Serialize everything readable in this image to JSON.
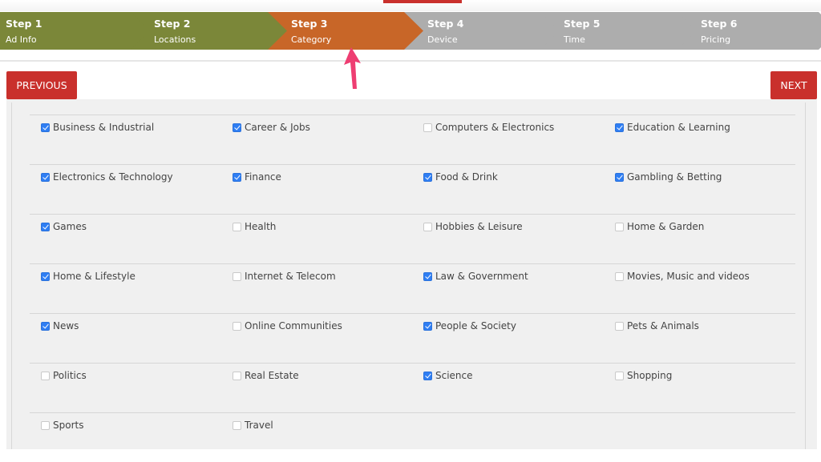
{
  "wizard": {
    "steps": [
      {
        "title": "Step 1",
        "subtitle": "Ad Info",
        "state": "done"
      },
      {
        "title": "Step 2",
        "subtitle": "Locations",
        "state": "done"
      },
      {
        "title": "Step 3",
        "subtitle": "Category",
        "state": "active"
      },
      {
        "title": "Step 4",
        "subtitle": "Device",
        "state": "todo"
      },
      {
        "title": "Step 5",
        "subtitle": "Time",
        "state": "todo"
      },
      {
        "title": "Step 6",
        "subtitle": "Pricing",
        "state": "todo"
      }
    ],
    "colors": {
      "done": "#7b8739",
      "active": "#c86628",
      "todo": "#adadad"
    }
  },
  "nav": {
    "previous_label": "PREVIOUS",
    "next_label": "NEXT",
    "button_color": "#c9302c"
  },
  "annotation": {
    "icon": "arrow-pointer-icon",
    "color": "#ee3e72",
    "points_to": "Step 3"
  },
  "categories": [
    [
      {
        "label": "Business & Industrial",
        "checked": true
      },
      {
        "label": "Career & Jobs",
        "checked": true
      },
      {
        "label": "Computers & Electronics",
        "checked": false
      },
      {
        "label": "Education & Learning",
        "checked": true
      }
    ],
    [
      {
        "label": "Electronics & Technology",
        "checked": true
      },
      {
        "label": "Finance",
        "checked": true
      },
      {
        "label": "Food & Drink",
        "checked": true
      },
      {
        "label": "Gambling & Betting",
        "checked": true
      }
    ],
    [
      {
        "label": "Games",
        "checked": true
      },
      {
        "label": "Health",
        "checked": false
      },
      {
        "label": "Hobbies & Leisure",
        "checked": false
      },
      {
        "label": "Home & Garden",
        "checked": false
      }
    ],
    [
      {
        "label": "Home & Lifestyle",
        "checked": true
      },
      {
        "label": "Internet & Telecom",
        "checked": false
      },
      {
        "label": "Law & Government",
        "checked": true
      },
      {
        "label": "Movies, Music and videos",
        "checked": false
      }
    ],
    [
      {
        "label": "News",
        "checked": true
      },
      {
        "label": "Online Communities",
        "checked": false
      },
      {
        "label": "People & Society",
        "checked": true
      },
      {
        "label": "Pets & Animals",
        "checked": false
      }
    ],
    [
      {
        "label": "Politics",
        "checked": false
      },
      {
        "label": "Real Estate",
        "checked": false
      },
      {
        "label": "Science",
        "checked": true
      },
      {
        "label": "Shopping",
        "checked": false
      }
    ],
    [
      {
        "label": "Sports",
        "checked": false
      },
      {
        "label": "Travel",
        "checked": false
      }
    ]
  ]
}
